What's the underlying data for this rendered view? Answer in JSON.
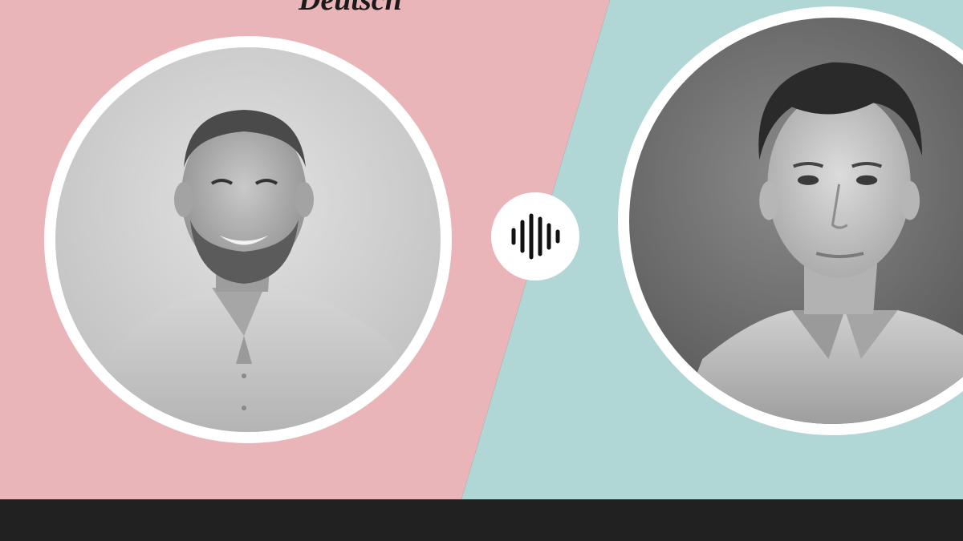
{
  "header": {
    "title_fragment": "Deutsch"
  },
  "guests": [
    {
      "icon": "person-portrait-icon",
      "style": "black-and-white photo, bald-ish man with beard, smiling"
    },
    {
      "icon": "person-portrait-icon",
      "style": "black-and-white photo, young man with swept hair"
    }
  ],
  "center_icon": "audio-waveform-icon",
  "colors": {
    "left_background": "#eab5b8",
    "right_background": "#b0d6d6",
    "footer": "#212121",
    "ring": "#ffffff"
  }
}
